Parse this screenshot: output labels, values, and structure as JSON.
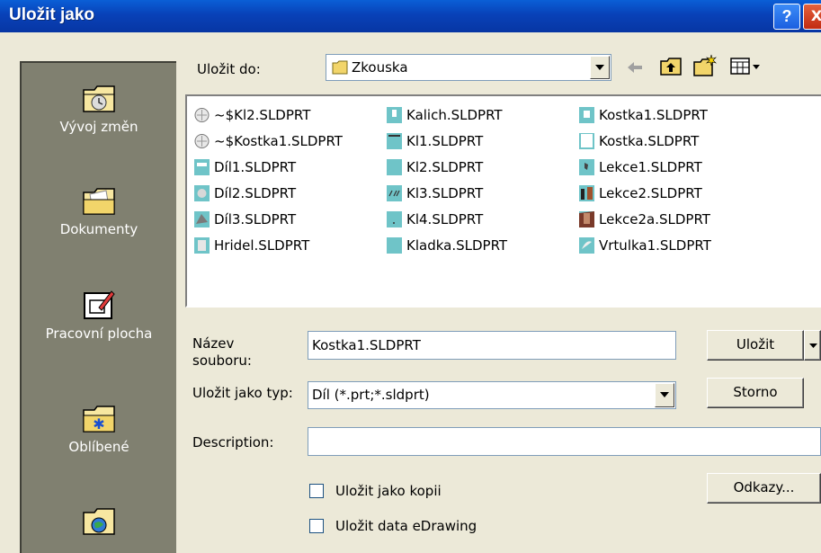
{
  "window": {
    "title": "Uložit jako",
    "help_label": "?",
    "close_label": "X"
  },
  "places": [
    {
      "label": "Vývoj změn",
      "icon": "history-folder-icon"
    },
    {
      "label": "Dokumenty",
      "icon": "documents-folder-icon"
    },
    {
      "label": "Pracovní plocha",
      "icon": "desktop-icon"
    },
    {
      "label": "Oblíbené",
      "icon": "favorites-folder-icon"
    },
    {
      "label": "",
      "icon": "network-places-icon"
    }
  ],
  "location": {
    "label": "Uložit do:",
    "value": "Zkouska"
  },
  "toolbar": {
    "icons": [
      "back-arrow-icon",
      "up-folder-icon",
      "new-folder-icon",
      "view-menu-icon"
    ]
  },
  "files": {
    "col1": [
      "~$Kl2.SLDPRT",
      "~$Kostka1.SLDPRT",
      "Díl1.SLDPRT",
      "Díl2.SLDPRT",
      "Díl3.SLDPRT",
      "Hridel.SLDPRT"
    ],
    "col2": [
      "Kalich.SLDPRT",
      "Kl1.SLDPRT",
      "Kl2.SLDPRT",
      "Kl3.SLDPRT",
      "Kl4.SLDPRT",
      "Kladka.SLDPRT"
    ],
    "col3": [
      "Kostka1.SLDPRT",
      "Kostka.SLDPRT",
      "Lekce1.SLDPRT",
      "Lekce2.SLDPRT",
      "Lekce2a.SLDPRT",
      "Vrtulka1.SLDPRT"
    ]
  },
  "filename": {
    "label_line1": "Název",
    "label_line2": "souboru:",
    "value": "Kostka1.SLDPRT"
  },
  "filetype": {
    "label": "Uložit jako typ:",
    "value": "Díl (*.prt;*.sldprt)"
  },
  "description": {
    "label": "Description:",
    "value": ""
  },
  "buttons": {
    "save": "Uložit",
    "cancel": "Storno",
    "references": "Odkazy..."
  },
  "options": {
    "save_copy": "Uložit jako kopii",
    "save_edrawing": "Uložit data eDrawing"
  },
  "colors": {
    "title_bar": "#0841b8",
    "places_bar": "#808070",
    "dialog_bg": "#ece9d8",
    "icon_teal": "#6fc4c8"
  }
}
